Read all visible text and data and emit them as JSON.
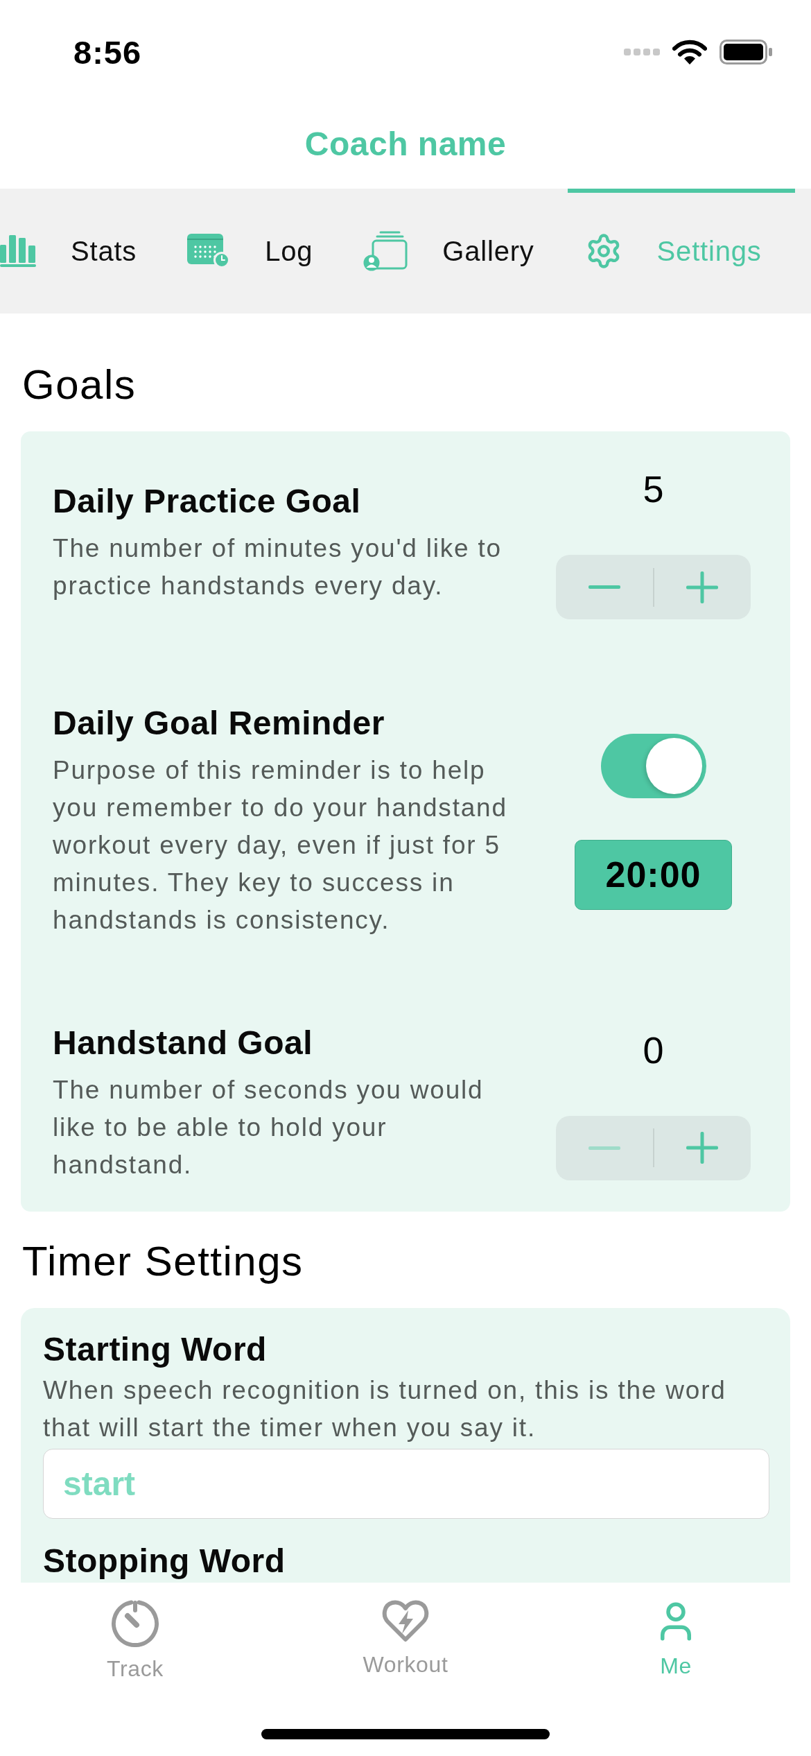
{
  "status_bar": {
    "time": "8:56"
  },
  "header": {
    "title": "Coach name"
  },
  "tabs": [
    {
      "label": "Stats",
      "selected": false
    },
    {
      "label": "Log",
      "selected": false
    },
    {
      "label": "Gallery",
      "selected": false
    },
    {
      "label": "Settings",
      "selected": true
    }
  ],
  "sections": [
    {
      "heading": "Goals",
      "items": [
        {
          "kind": "stepper",
          "title": "Daily Practice Goal",
          "description": "The number of minutes you'd like to practice handstands every day.",
          "value": "5",
          "decrement_disabled": false
        },
        {
          "kind": "reminder",
          "title": "Daily Goal Reminder",
          "description": "Purpose of this reminder is to help you remember to do your handstand workout every day, even if just for 5 minutes. They key to success in handstands is consistency.",
          "on": true,
          "time": "20:00"
        },
        {
          "kind": "stepper",
          "title": "Handstand Goal",
          "description": "The number of seconds you would like to be able to hold your handstand.",
          "value": "0",
          "decrement_disabled": true
        }
      ]
    },
    {
      "heading": "Timer Settings",
      "items": [
        {
          "kind": "text_field",
          "title": "Starting Word",
          "description": "When speech recognition is turned on, this is the word that will start the timer when you say it.",
          "value": "start"
        },
        {
          "kind": "text_field",
          "title": "Stopping Word"
        }
      ]
    }
  ],
  "bottom_nav": [
    {
      "label": "Track",
      "selected": false
    },
    {
      "label": "Workout",
      "selected": false
    },
    {
      "label": "Me",
      "selected": true
    }
  ]
}
